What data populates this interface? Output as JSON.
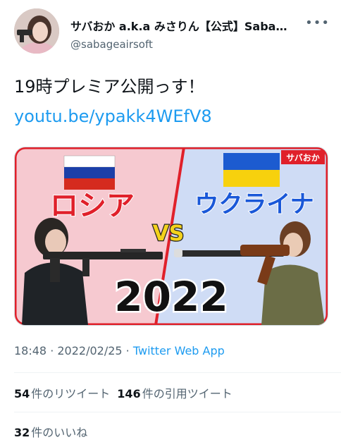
{
  "author": {
    "display_name": "サバおか a.k.a みさりん【公式】Saba…",
    "handle": "@sabageairsoft"
  },
  "icons": {
    "more": "more-icon",
    "avatar": "avatar"
  },
  "tweet": {
    "text": "19時プレミア公開っす！",
    "link": "youtu.be/ypakk4WEfV8"
  },
  "thumbnail": {
    "channel_badge": "サバおか",
    "left_label": "ロシア",
    "right_label": "ウクライナ",
    "vs_label": "VS",
    "year_label": "2022",
    "colors": {
      "left_bg": "#f6c9d0",
      "right_bg": "#cfdcf5",
      "divider": "#e0202a",
      "left_text": "#e0202a",
      "right_text": "#1a58d8",
      "vs": "#f4d21c"
    }
  },
  "meta": {
    "time": "18:48",
    "sep": " · ",
    "date": "2022/02/25",
    "app": "Twitter Web App"
  },
  "stats": {
    "retweets_count": "54",
    "retweets_label": "件のリツイート",
    "quotes_count": "146",
    "quotes_label": "件の引用ツイート",
    "likes_count": "32",
    "likes_label": "件のいいね"
  }
}
